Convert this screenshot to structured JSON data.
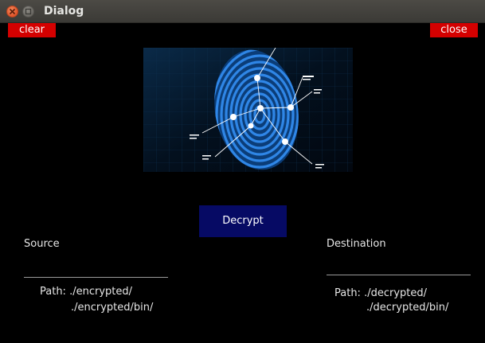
{
  "window": {
    "title": "Dialog"
  },
  "buttons": {
    "clear": "clear",
    "close": "close",
    "decrypt": "Decrypt"
  },
  "source": {
    "label": "Source",
    "value": "",
    "path_label": "Path:",
    "path1": "./encrypted/",
    "path2": "./encrypted/bin/"
  },
  "destination": {
    "label": "Destination",
    "value": "",
    "path_label": "Path:",
    "path1": "./decrypted/",
    "path2": "./decrypted/bin/"
  },
  "image": {
    "name": "fingerprint-scan-image"
  },
  "colors": {
    "danger": "#d40000",
    "primary": "#060a64",
    "fingerprint": "#1e6fd0"
  }
}
